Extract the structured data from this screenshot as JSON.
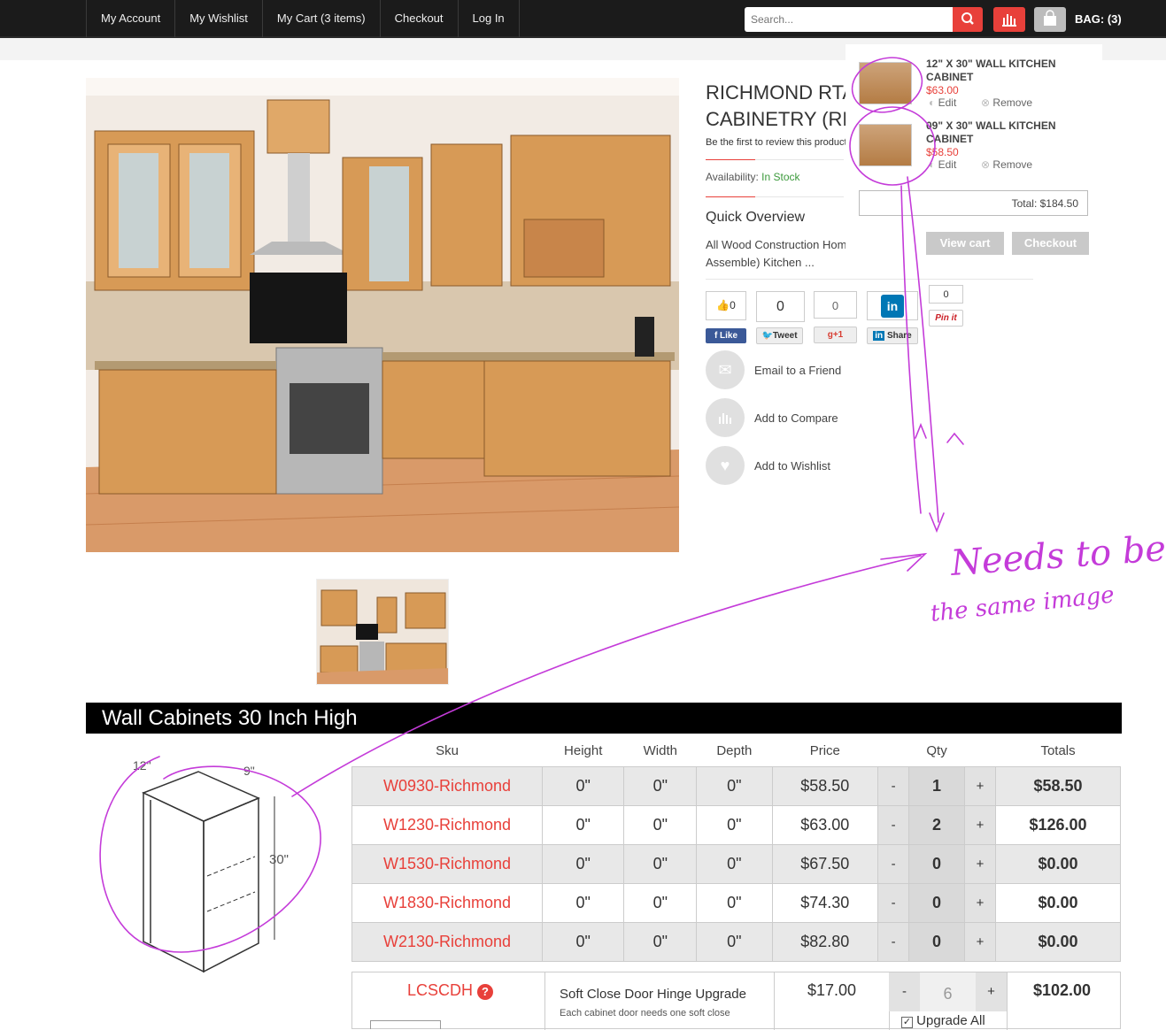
{
  "nav": {
    "items": [
      "My Account",
      "My Wishlist",
      "My Cart (3 items)",
      "Checkout",
      "Log In"
    ]
  },
  "search": {
    "placeholder": "Search..."
  },
  "bag": {
    "label": "BAG: (3)"
  },
  "product": {
    "title_line1": "RICHMOND RTA",
    "title_line2": "CABINETRY (RE",
    "review_text": "Be the first to review this product",
    "availability_label": "Availability:",
    "availability_value": "In Stock",
    "quick_overview": "Quick Overview",
    "overview_line1": "All Wood Construction Hom",
    "overview_line2": "Assemble) Kitchen ..."
  },
  "social": {
    "like_count": "0",
    "like_label": "Like",
    "tweet_count": "0",
    "tweet_label": "Tweet",
    "gplus_count": "0",
    "gplus_label": "g+1",
    "share_label": "Share",
    "pin_count": "0",
    "pin_label": "Pin it"
  },
  "actions": [
    "Email to a Friend",
    "Add to Compare",
    "Add to Wishlist"
  ],
  "cart": {
    "items": [
      {
        "name_line1": "12\" X 30\" WALL KITCHEN",
        "name_line2": "CABINET",
        "price": "$63.00",
        "edit": "Edit",
        "remove": "Remove"
      },
      {
        "name_line1": "09\" X 30\" WALL KITCHEN",
        "name_line2": "CABINET",
        "price": "$58.50",
        "edit": "Edit",
        "remove": "Remove"
      }
    ],
    "total": "Total: $184.50",
    "view_cart": "View cart",
    "checkout": "Checkout"
  },
  "section": {
    "title": "Wall Cabinets 30 Inch High"
  },
  "diagram": {
    "depth": "12\"",
    "width": "9\"",
    "height": "30\""
  },
  "table": {
    "headers": [
      "Sku",
      "Height",
      "Width",
      "Depth",
      "Price",
      "Qty",
      "Totals"
    ],
    "rows": [
      {
        "sku": "W0930-Richmond",
        "height": "0\"",
        "width": "0\"",
        "depth": "0\"",
        "price": "$58.50",
        "minus": "-",
        "qty": "1",
        "plus": "+",
        "total": "$58.50"
      },
      {
        "sku": "W1230-Richmond",
        "height": "0\"",
        "width": "0\"",
        "depth": "0\"",
        "price": "$63.00",
        "minus": "-",
        "qty": "2",
        "plus": "+",
        "total": "$126.00"
      },
      {
        "sku": "W1530-Richmond",
        "height": "0\"",
        "width": "0\"",
        "depth": "0\"",
        "price": "$67.50",
        "minus": "-",
        "qty": "0",
        "plus": "+",
        "total": "$0.00"
      },
      {
        "sku": "W1830-Richmond",
        "height": "0\"",
        "width": "0\"",
        "depth": "0\"",
        "price": "$74.30",
        "minus": "-",
        "qty": "0",
        "plus": "+",
        "total": "$0.00"
      },
      {
        "sku": "W2130-Richmond",
        "height": "0\"",
        "width": "0\"",
        "depth": "0\"",
        "price": "$82.80",
        "minus": "-",
        "qty": "0",
        "plus": "+",
        "total": "$0.00"
      }
    ]
  },
  "upgrade": {
    "sku": "LCSCDH",
    "help": "?",
    "title": "Soft Close Door Hinge Upgrade",
    "desc": "Each cabinet door needs one soft close",
    "price": "$17.00",
    "minus": "-",
    "qty": "6",
    "plus": "+",
    "total": "$102.00",
    "upgrade_all": "Upgrade All"
  },
  "annotation": {
    "line1": "Needs to be",
    "line2": "the same image"
  },
  "colors": {
    "accent": "#e8403a",
    "annotation": "#c43bd9",
    "header_bg": "#1b1b1b",
    "stock": "#3c9a3c"
  }
}
